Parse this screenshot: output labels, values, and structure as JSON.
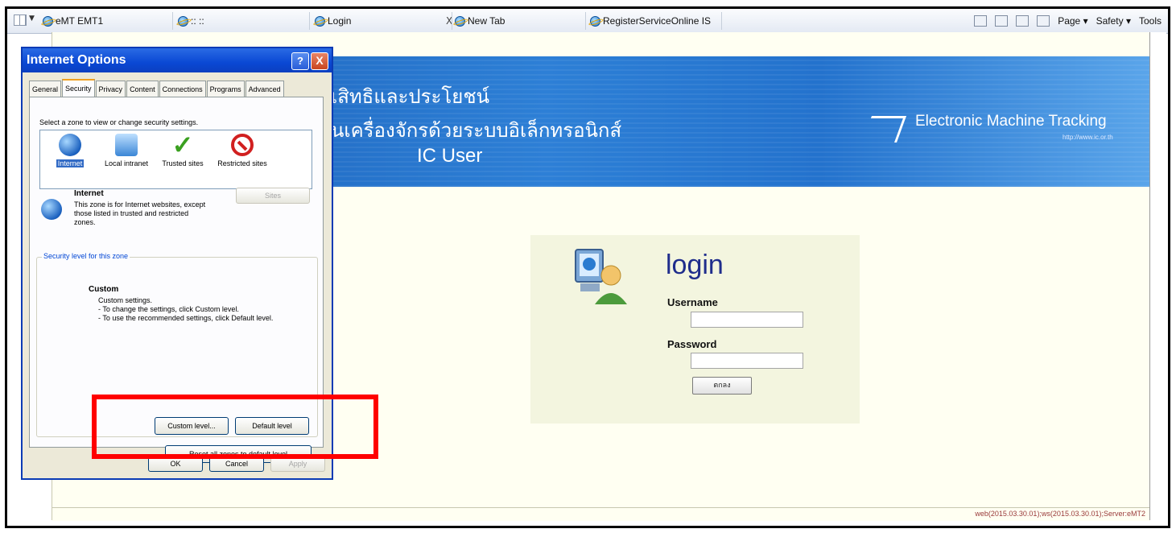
{
  "browser": {
    "tabs": [
      {
        "label": "eMT EMT1"
      },
      {
        "label": ":: ::"
      },
      {
        "label": "Login"
      },
      {
        "label": "New Tab"
      },
      {
        "label": "RegisterServiceOnline IS"
      }
    ],
    "close_glyph": "X",
    "command_bar": {
      "page": "Page ▾",
      "safety": "Safety ▾",
      "tools": "Tools"
    }
  },
  "banner": {
    "line1": "เสิทธิและประโยชน์",
    "line2": "นเครื่องจักรด้วยระบบอิเล็กทรอนิกส์",
    "line3": "IC User",
    "brand": "Electronic Machine Tracking",
    "url": "http://www.ic.or.th"
  },
  "login": {
    "title": "login",
    "username_label": "Username",
    "username_value": "",
    "password_label": "Password",
    "password_value": "",
    "submit_label": "ตกลง"
  },
  "footer": {
    "text": "web(2015.03.30.01);ws(2015.03.30.01);Server:eMT2"
  },
  "dialog": {
    "title": "Internet Options",
    "help": "?",
    "close": "X",
    "tabs": [
      "General",
      "Security",
      "Privacy",
      "Content",
      "Connections",
      "Programs",
      "Advanced"
    ],
    "active_tab": "Security",
    "zone_prompt": "Select a zone to view or change security settings.",
    "zones": [
      {
        "label": "Internet",
        "icon": "globe-icon"
      },
      {
        "label": "Local intranet",
        "icon": "intranet-icon"
      },
      {
        "label": "Trusted sites",
        "icon": "check-icon"
      },
      {
        "label": "Restricted sites",
        "icon": "no-entry-icon"
      }
    ],
    "zone_name": "Internet",
    "zone_desc": "This zone is for Internet websites, except those listed in trusted and restricted zones.",
    "sites_button": "Sites",
    "security_legend": "Security level for this zone",
    "level_name": "Custom",
    "level_desc": "Custom settings.",
    "level_bullet1": "- To change the settings, click Custom level.",
    "level_bullet2": "- To use the recommended settings, click Default level.",
    "custom_level_button": "Custom level...",
    "default_level_button": "Default level",
    "reset_button": "Reset all zones to default level",
    "ok": "OK",
    "cancel": "Cancel",
    "apply": "Apply"
  },
  "colors": {
    "highlight": "#ff0000",
    "title_bar": "#0a48d4",
    "banner": "#2372cd"
  }
}
